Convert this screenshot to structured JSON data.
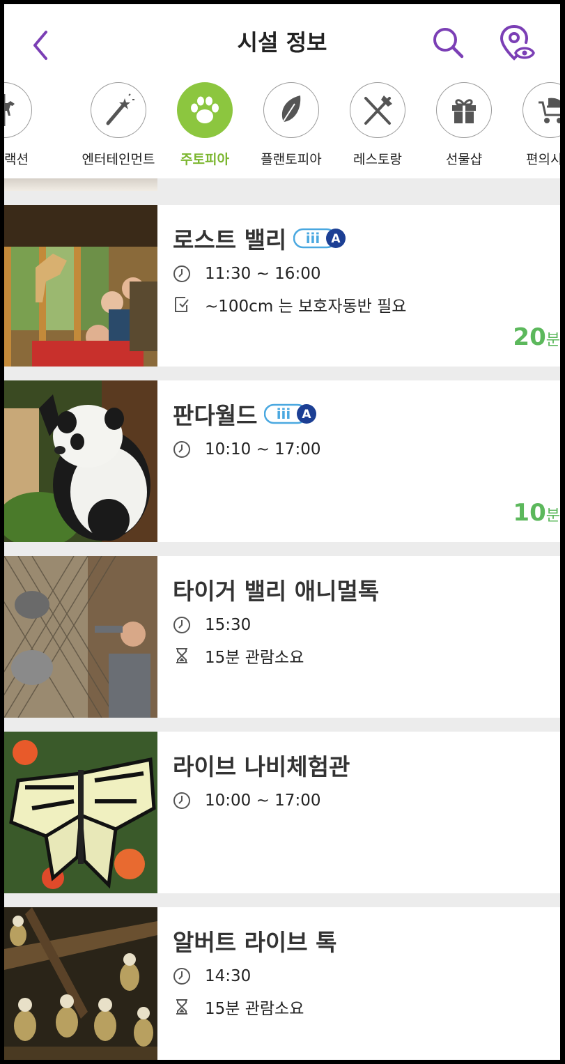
{
  "header": {
    "title": "시설 정보"
  },
  "categories": [
    {
      "label": "어트랙션",
      "icon": "carousel-horse-icon"
    },
    {
      "label": "엔터테인먼트",
      "icon": "magic-wand-icon"
    },
    {
      "label": "주토피아",
      "icon": "paw-icon",
      "active": true
    },
    {
      "label": "플랜토피아",
      "icon": "leaf-icon"
    },
    {
      "label": "레스토랑",
      "icon": "fork-knife-icon"
    },
    {
      "label": "선물샵",
      "icon": "gift-icon"
    },
    {
      "label": "편의시설",
      "icon": "stroller-icon"
    }
  ],
  "facilities": [
    {
      "name": "로스트 밸리",
      "time": "11:30 ~ 16:00",
      "note": "~100cm 는 보호자동반 필요",
      "wait_value": "20",
      "wait_unit": "분"
    },
    {
      "name": "판다월드",
      "time": "10:10 ~ 17:00",
      "wait_value": "10",
      "wait_unit": "분"
    },
    {
      "name": "타이거 밸리 애니멀톡",
      "time": "15:30",
      "duration": "15분 관람소요"
    },
    {
      "name": "라이브 나비체험관",
      "time": "10:00 ~ 17:00"
    },
    {
      "name": "알버트 라이브 톡",
      "time": "14:30",
      "duration": "15분 관람소요"
    }
  ],
  "badge": {
    "text": "iii",
    "letter": "A"
  },
  "colors": {
    "accent": "#7b3fb5",
    "active_green": "#8cc63f",
    "wait_green": "#5cb85c",
    "badge_blue": "#3a7fd5"
  }
}
